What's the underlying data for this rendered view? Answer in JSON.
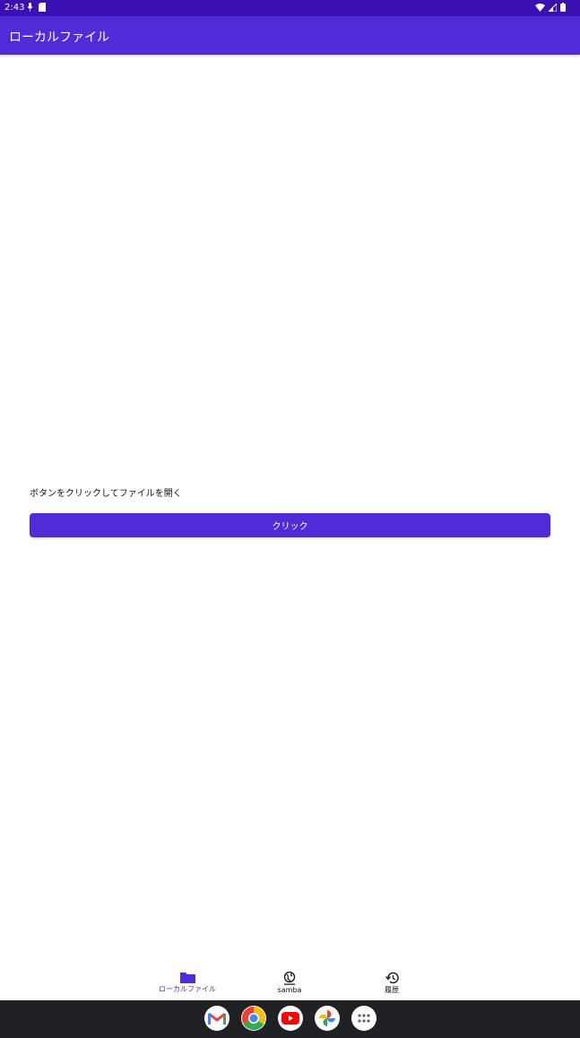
{
  "status_bar": {
    "time": "2:43"
  },
  "app_bar": {
    "title": "ローカルファイル"
  },
  "main": {
    "prompt": "ボタンをクリックしてファイルを開く",
    "button_label": "クリック"
  },
  "bottom_nav": {
    "items": [
      {
        "label": "ローカルファイル",
        "icon": "folder-icon",
        "active": true
      },
      {
        "label": "samba",
        "icon": "globe-icon",
        "active": false
      },
      {
        "label": "履歴",
        "icon": "history-icon",
        "active": false
      }
    ]
  },
  "dock": {
    "apps": [
      "gmail-icon",
      "chrome-icon",
      "youtube-icon",
      "photos-icon",
      "app-drawer-icon"
    ]
  },
  "colors": {
    "primary": "#512bd8",
    "status_bar": "#3a10b3",
    "nav_bar": "#202124"
  }
}
